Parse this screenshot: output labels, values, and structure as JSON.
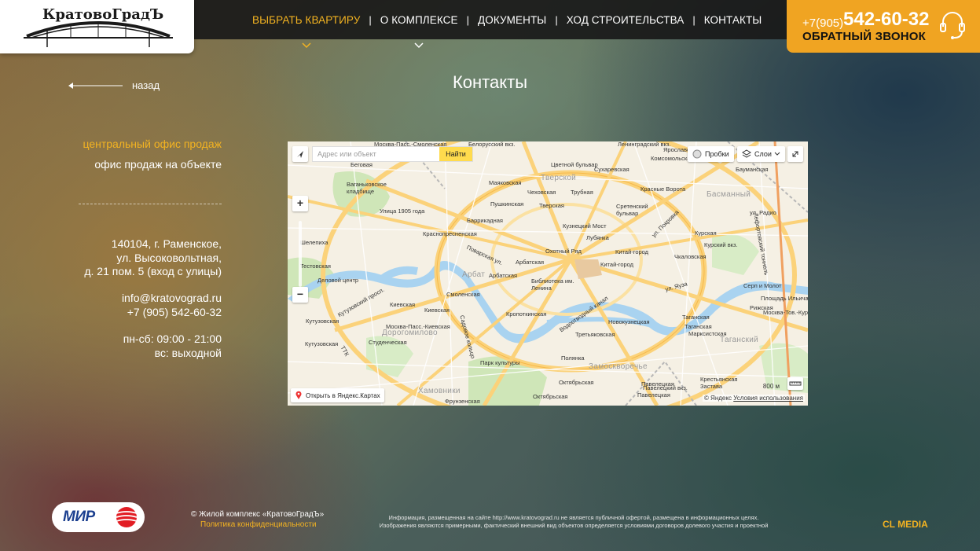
{
  "header": {
    "logo_text": "КратовоГрадЪ",
    "nav": [
      {
        "label": "ВЫБРАТЬ КВАРТИРУ",
        "active": true,
        "has_dropdown": true
      },
      {
        "label": "О КОМПЛЕКСЕ",
        "active": false,
        "has_dropdown": true
      },
      {
        "label": "ДОКУМЕНТЫ",
        "active": false,
        "has_dropdown": false
      },
      {
        "label": "ХОД СТРОИТЕЛЬСТВА",
        "active": false,
        "has_dropdown": false
      },
      {
        "label": "КОНТАКТЫ",
        "active": false,
        "has_dropdown": false
      }
    ],
    "phone_prefix": "+7(905)",
    "phone_number": "542-60-32",
    "callback_label": "ОБРАТНЫЙ ЗВОНОК"
  },
  "page": {
    "back_label": "назад",
    "title": "Контакты"
  },
  "offices": [
    "центральный офис продаж",
    "офис продаж на объекте"
  ],
  "contact": {
    "address": [
      "140104, г. Раменское,",
      "ул. Высоковольтная,",
      "д. 21 пом. 5 (вход с улицы)"
    ],
    "email": "info@kratovograd.ru",
    "phone": "+7 (905) 542-60-32",
    "hours_weekdays": "пн-сб: 09:00 - 21:00",
    "hours_sunday": "вс: выходной"
  },
  "map": {
    "search_placeholder": "Адрес или объект",
    "search_button": "Найти",
    "traffic_label": "Пробки",
    "layers_label": "Слои",
    "zoom_in": "+",
    "zoom_out": "−",
    "open_label": "Открыть в Яндекс.Картах",
    "scale_label": "800 м",
    "copyright": "© Яндекс",
    "terms_label": "Условия использования",
    "labels": [
      "Москва-Пасс.-Смоленская",
      "Белорусский вкз.",
      "Ленинградский вкз.",
      "Ярославский вкз.",
      "Беговая",
      "Цветной бульвар",
      "Сухаревская",
      "Комсомольская",
      "Бауманская",
      "Ваганьковское кладбище",
      "Маяковская",
      "Тверской",
      "Чеховская",
      "Трубная",
      "Красные Ворота",
      "Басманный",
      "Улица 1905 года",
      "Пушкинская",
      "Тверская",
      "Сретенский бульвар",
      "ул. Радио",
      "Баррикадная",
      "Кузнецкий Мост",
      "Курская",
      "Шелепиха",
      "Краснопресненская",
      "Лубянка",
      "Курский вкз.",
      "Охотный Ряд",
      "Китай-город",
      "Чкаловская",
      "Тестовская",
      "Арбатская",
      "Китай-город",
      "Деловой центр",
      "Арбат",
      "Арбатская",
      "Библиотека им. Ленина",
      "Серп и Молот",
      "Смоленская",
      "Площадь Ильича",
      "Рижская",
      "Москва-Тов.-Курская",
      "Киевская",
      "Киевская",
      "Кропоткинская",
      "Таганская",
      "Москва-Пасс.-Киевская",
      "Новокузнецкая",
      "Таганская",
      "Студенческая",
      "Кутузовская",
      "Дорогомилово",
      "Третьяковская",
      "Марксистская",
      "Таганский",
      "Полянка",
      "Замоскворечье",
      "Парк культуры",
      "Октябрьская",
      "Павелецкая",
      "Крестьянская Застава",
      "Хамовники",
      "Октябрьская",
      "Павелецкий вкз.",
      "Павелецкая",
      "Фрунзенская",
      "Кутузовский просп.",
      "Лефортовский тоннель",
      "Поварская ул.",
      "Садовое кольцо",
      "ул. Покровка",
      "ул. Яузa",
      "ТТК",
      "Водоотводный канал",
      "Кутузовская"
    ],
    "districts": [
      "Тверской",
      "Басманный",
      "Арбат",
      "Дорогомилово",
      "Таганский",
      "Замоскворечье",
      "Хамовники"
    ]
  },
  "footer": {
    "partner_logo": "МИР",
    "copyright": "© Жилой комплекс «КратовоГрадЪ»",
    "privacy": "Политика конфиденциальности",
    "disclaimer_1": "Информация, размещенная на сайте http://www.kratovograd.ru не является публичной офертой, размещена в информационных целях.",
    "disclaimer_2": "Изображения являются примерными, фактический внешний вид объектов определяется условиями договоров долевого участия и проектной",
    "developer": "CL MEDIA"
  },
  "colors": {
    "accent": "#f3b321",
    "callbox": "#f0a422",
    "topbar": "#191919",
    "map_river": "#a9d3f0",
    "map_park": "#cfe6b8",
    "map_road": "#fbd27a"
  }
}
